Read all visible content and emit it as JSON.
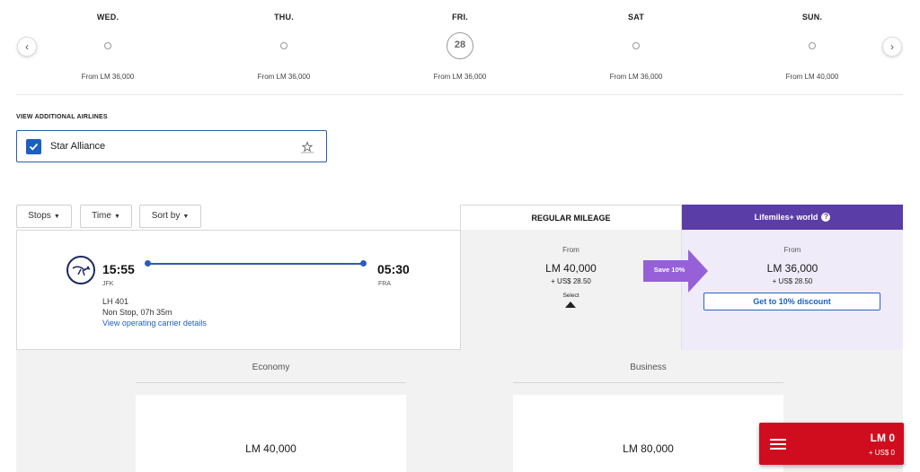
{
  "date_strip": {
    "days": [
      {
        "day": "WED.",
        "price": "From LM 36,000",
        "selected": false,
        "date": ""
      },
      {
        "day": "THU.",
        "price": "From LM 36,000",
        "selected": false,
        "date": ""
      },
      {
        "day": "FRI.",
        "price": "From LM 36,000",
        "selected": true,
        "date": "28"
      },
      {
        "day": "SAT",
        "price": "From LM 36,000",
        "selected": false,
        "date": ""
      },
      {
        "day": "SUN.",
        "price": "From LM 40,000",
        "selected": false,
        "date": ""
      }
    ],
    "prev_label": "‹",
    "next_label": "›"
  },
  "additional_airlines": {
    "title": "VIEW ADDITIONAL AIRLINES",
    "alliance_label": "Star Alliance",
    "checked": true
  },
  "filters": {
    "stops": "Stops",
    "time": "Time",
    "sort": "Sort by"
  },
  "tabs": {
    "regular": "REGULAR MILEAGE",
    "lifemiles": "Lifemiles+ world",
    "help": "?"
  },
  "flight": {
    "departure_time": "15:55",
    "departure_code": "JFK",
    "arrival_time": "05:30",
    "arrival_code": "FRA",
    "flight_number": "LH 401",
    "duration": "Non Stop, 07h 35m",
    "carrier_link": "View operating carrier details"
  },
  "regular_fare": {
    "from": "From",
    "miles": "LM 40,000",
    "tax": "+ US$ 28.50",
    "select": "Select"
  },
  "lifemiles_fare": {
    "from": "From",
    "miles": "LM 36,000",
    "tax": "+ US$ 28.50",
    "discount_button": "Get to 10% discount",
    "save_badge": "Save 10%"
  },
  "cabins": [
    {
      "name": "Economy",
      "price": "LM 40,000"
    },
    {
      "name": "Business",
      "price": "LM 80,000"
    }
  ],
  "cart": {
    "miles": "LM 0",
    "usd": "+ US$ 0"
  },
  "colors": {
    "accent_purple": "#5a3da6",
    "link_blue": "#1d5fc1",
    "cart_red": "#d00d1e",
    "badge_purple": "#9560d8"
  }
}
